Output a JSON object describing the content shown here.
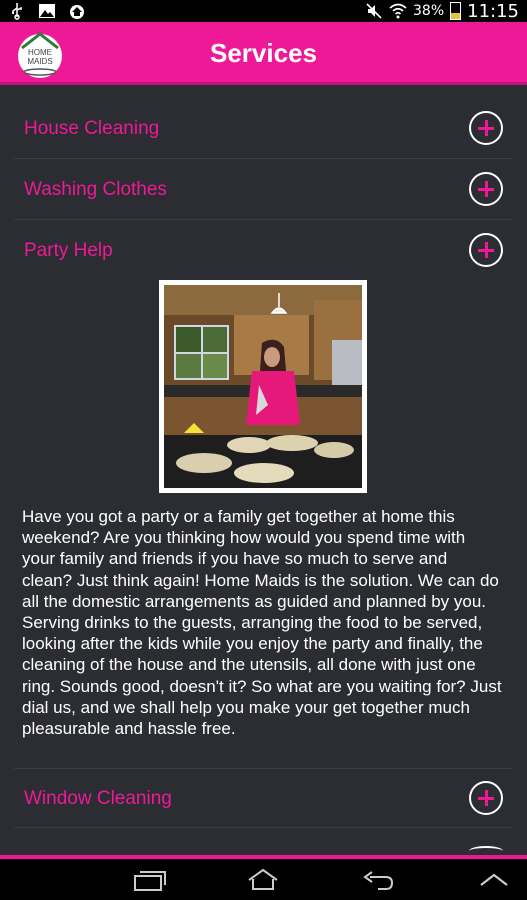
{
  "status_bar": {
    "battery_percent": "38%",
    "time": "11:15",
    "icons": [
      "usb-icon",
      "image-icon",
      "app-notification-icon",
      "mute-icon",
      "wifi-icon",
      "battery-icon"
    ]
  },
  "app_bar": {
    "logo_text": "HOME MAIDS",
    "logo_line1": "HOME",
    "logo_line2": "MAIDS",
    "title": "Services"
  },
  "services": [
    {
      "label": "House Cleaning",
      "expanded": false
    },
    {
      "label": "Washing Clothes",
      "expanded": false
    },
    {
      "label": "Party Help",
      "expanded": true
    },
    {
      "label": "Window Cleaning",
      "expanded": false
    }
  ],
  "party_help": {
    "description": "Have you got a party or a family get together at home this weekend? Are you thinking how would you spend time with your family and friends if you have so much to serve and clean? Just think again! Home Maids is the solution. We can do all the domestic arrangements as guided and planned by you. Serving drinks to the guests, arranging the food to be served, looking after the kids while you enjoy the party and finally, the cleaning of the house and the utensils, all done with just one ring. Sounds good, doesn't it? So what are you waiting for? Just dial us, and we shall help you make your get together much pleasurable and hassle free."
  },
  "nav_bar": {
    "buttons": [
      "recent-apps",
      "home",
      "back",
      "menu"
    ]
  },
  "colors": {
    "accent": "#ee1996",
    "background": "#2b2d33",
    "text": "#ffffff"
  }
}
